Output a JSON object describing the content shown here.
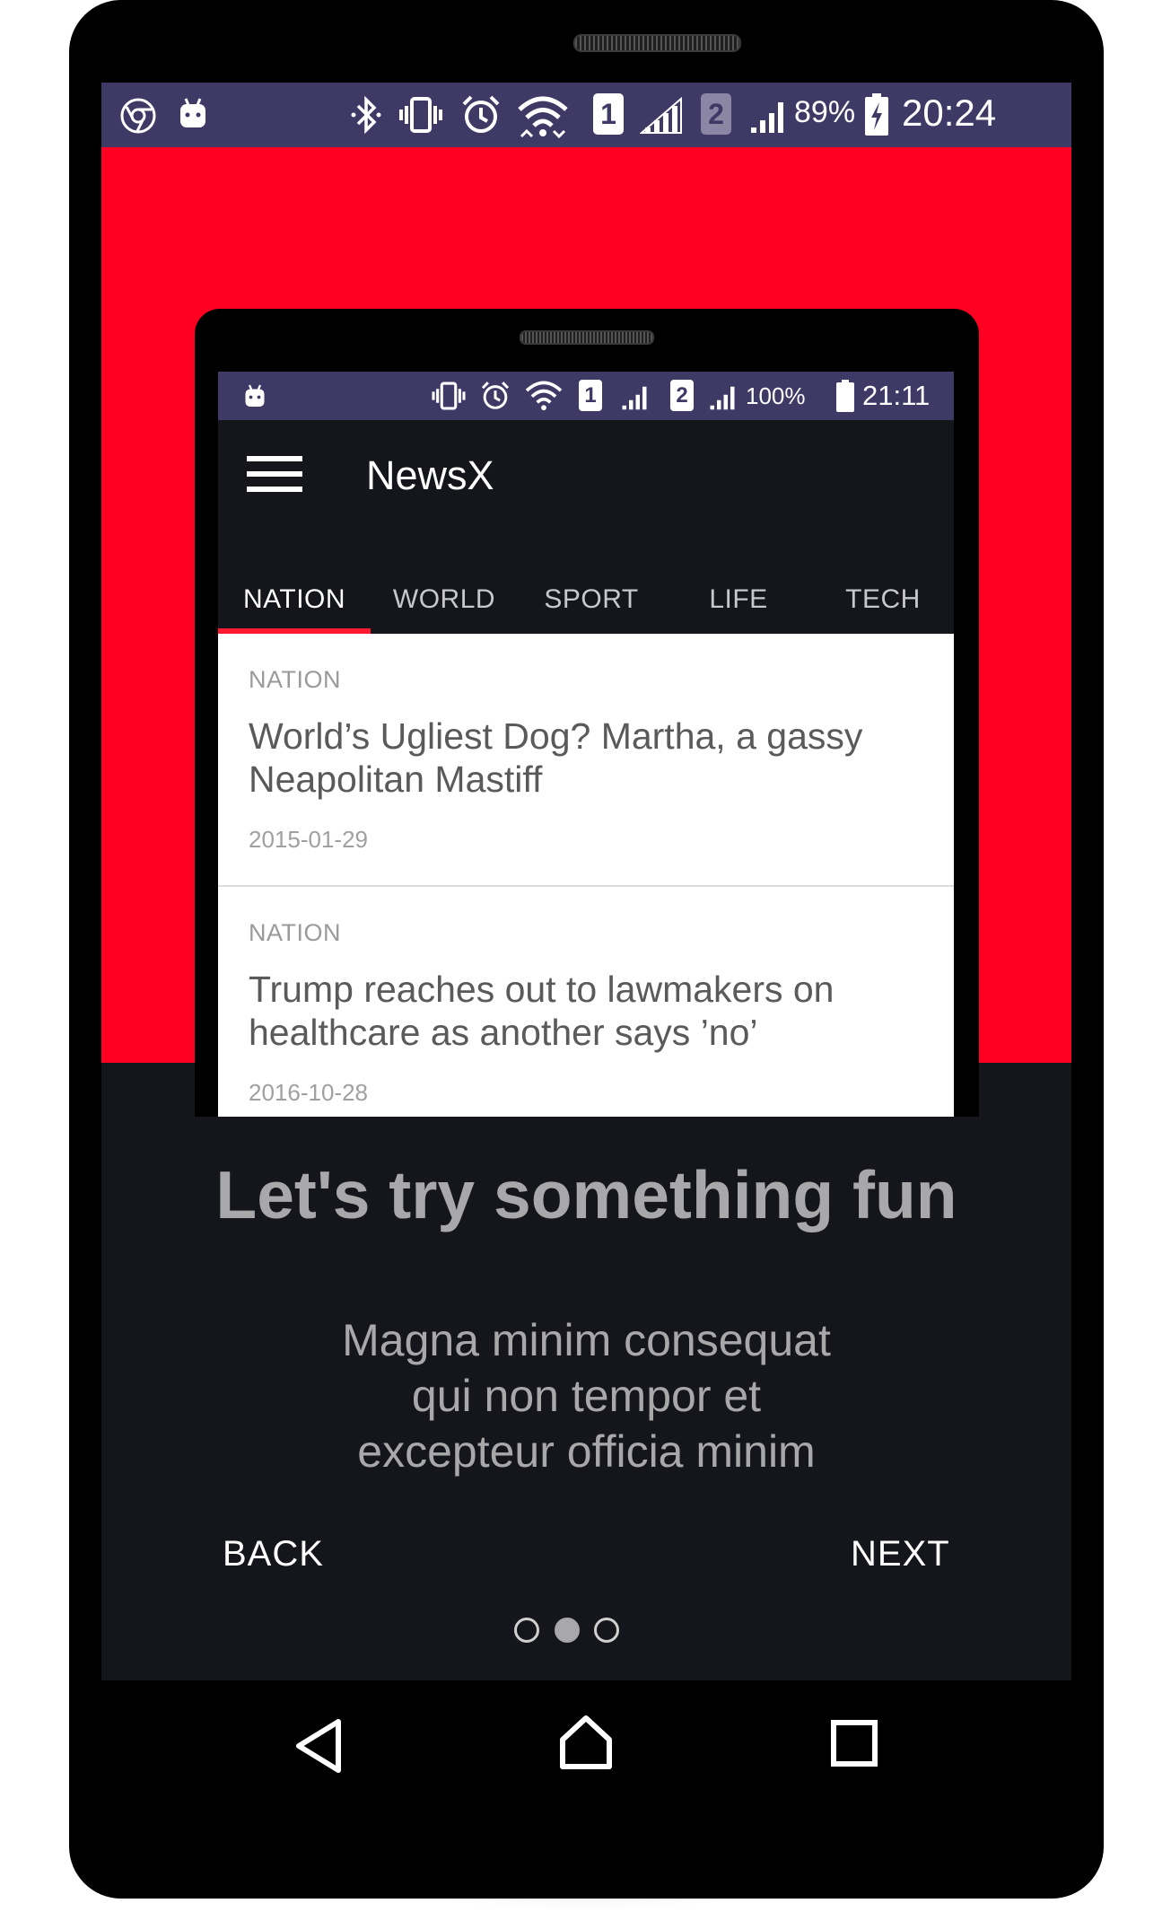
{
  "outer_status": {
    "sim1": "1",
    "sim2": "2",
    "battery_pct": "89%",
    "time": "20:24"
  },
  "inner_status": {
    "sim1": "1",
    "sim2": "2",
    "battery_pct": "100%",
    "time": "21:11"
  },
  "app": {
    "title": "NewsX",
    "tabs": [
      {
        "label": "NATION"
      },
      {
        "label": "WORLD"
      },
      {
        "label": "SPORT"
      },
      {
        "label": "LIFE"
      },
      {
        "label": "TECH"
      }
    ],
    "active_tab": "NATION",
    "articles": [
      {
        "section": "NATION",
        "title_line1": "World’s Ugliest Dog? Martha, a gassy",
        "title_line2": "Neapolitan Mastiff",
        "date": "2015-01-29"
      },
      {
        "section": "NATION",
        "title_line1": "Trump reaches out to lawmakers on",
        "title_line2": "healthcare as another says ’no’",
        "date": "2016-10-28"
      }
    ]
  },
  "onboarding": {
    "headline": "Let's try something fun",
    "body_line1": "Magna minim consequat",
    "body_line2": "qui non tempor et",
    "body_line3": "excepteur officia minim",
    "back_label": "BACK",
    "next_label": "NEXT",
    "page_count": 3,
    "current_page": 2
  },
  "colors": {
    "status_bar": "#3f3966",
    "accent_red": "#ff0022",
    "dark_bg": "#15161b"
  },
  "icons": {
    "system_nav": [
      "back-icon",
      "home-icon",
      "recents-icon"
    ]
  }
}
